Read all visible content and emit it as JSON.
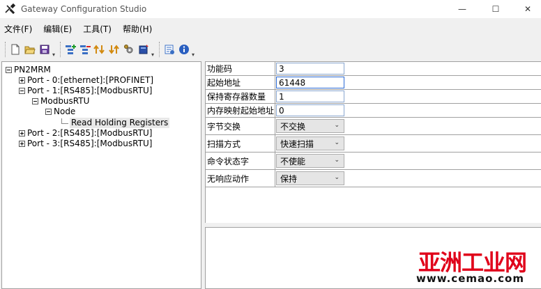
{
  "window": {
    "title": "Gateway Configuration Studio",
    "controls": {
      "minimize": "—",
      "maximize": "☐",
      "close": "✕"
    }
  },
  "menu": [
    "文件(F)",
    "编辑(E)",
    "工具(T)",
    "帮助(H)"
  ],
  "toolbar": {
    "icons": [
      "new-file-icon",
      "open-folder-icon",
      "save-icon",
      "add-node-icon",
      "delete-node-icon",
      "upload-icon",
      "download-icon",
      "settings-icon",
      "monitor-icon",
      "diagnose-icon",
      "about-icon"
    ]
  },
  "tree": {
    "root": "PN2MRM",
    "port0": "Port - 0:[ethernet]:[PROFINET]",
    "port1": "Port - 1:[RS485]:[ModbusRTU]",
    "modbus": "ModbusRTU",
    "node": "Node",
    "command": "Read Holding Registers",
    "port2": "Port - 2:[RS485]:[ModbusRTU]",
    "port3": "Port - 3:[RS485]:[ModbusRTU]"
  },
  "properties": [
    {
      "label": "功能码",
      "value": "3",
      "kind": "input"
    },
    {
      "label": "起始地址",
      "value": "61448",
      "kind": "input"
    },
    {
      "label": "保持寄存器数量",
      "value": "1",
      "kind": "input"
    },
    {
      "label": "内存映射起始地址",
      "value": "0",
      "kind": "input"
    },
    {
      "label": "字节交换",
      "value": "不交换",
      "kind": "select"
    },
    {
      "label": "扫描方式",
      "value": "快速扫描",
      "kind": "select"
    },
    {
      "label": "命令状态字",
      "value": "不使能",
      "kind": "select"
    },
    {
      "label": "无响应动作",
      "value": "保持",
      "kind": "select"
    }
  ],
  "watermark": {
    "title": "亚洲工业网",
    "url": "www.cemao.com"
  },
  "colors": {
    "watermark_red": "#e0001a",
    "input_border": "#8aa7d0"
  }
}
